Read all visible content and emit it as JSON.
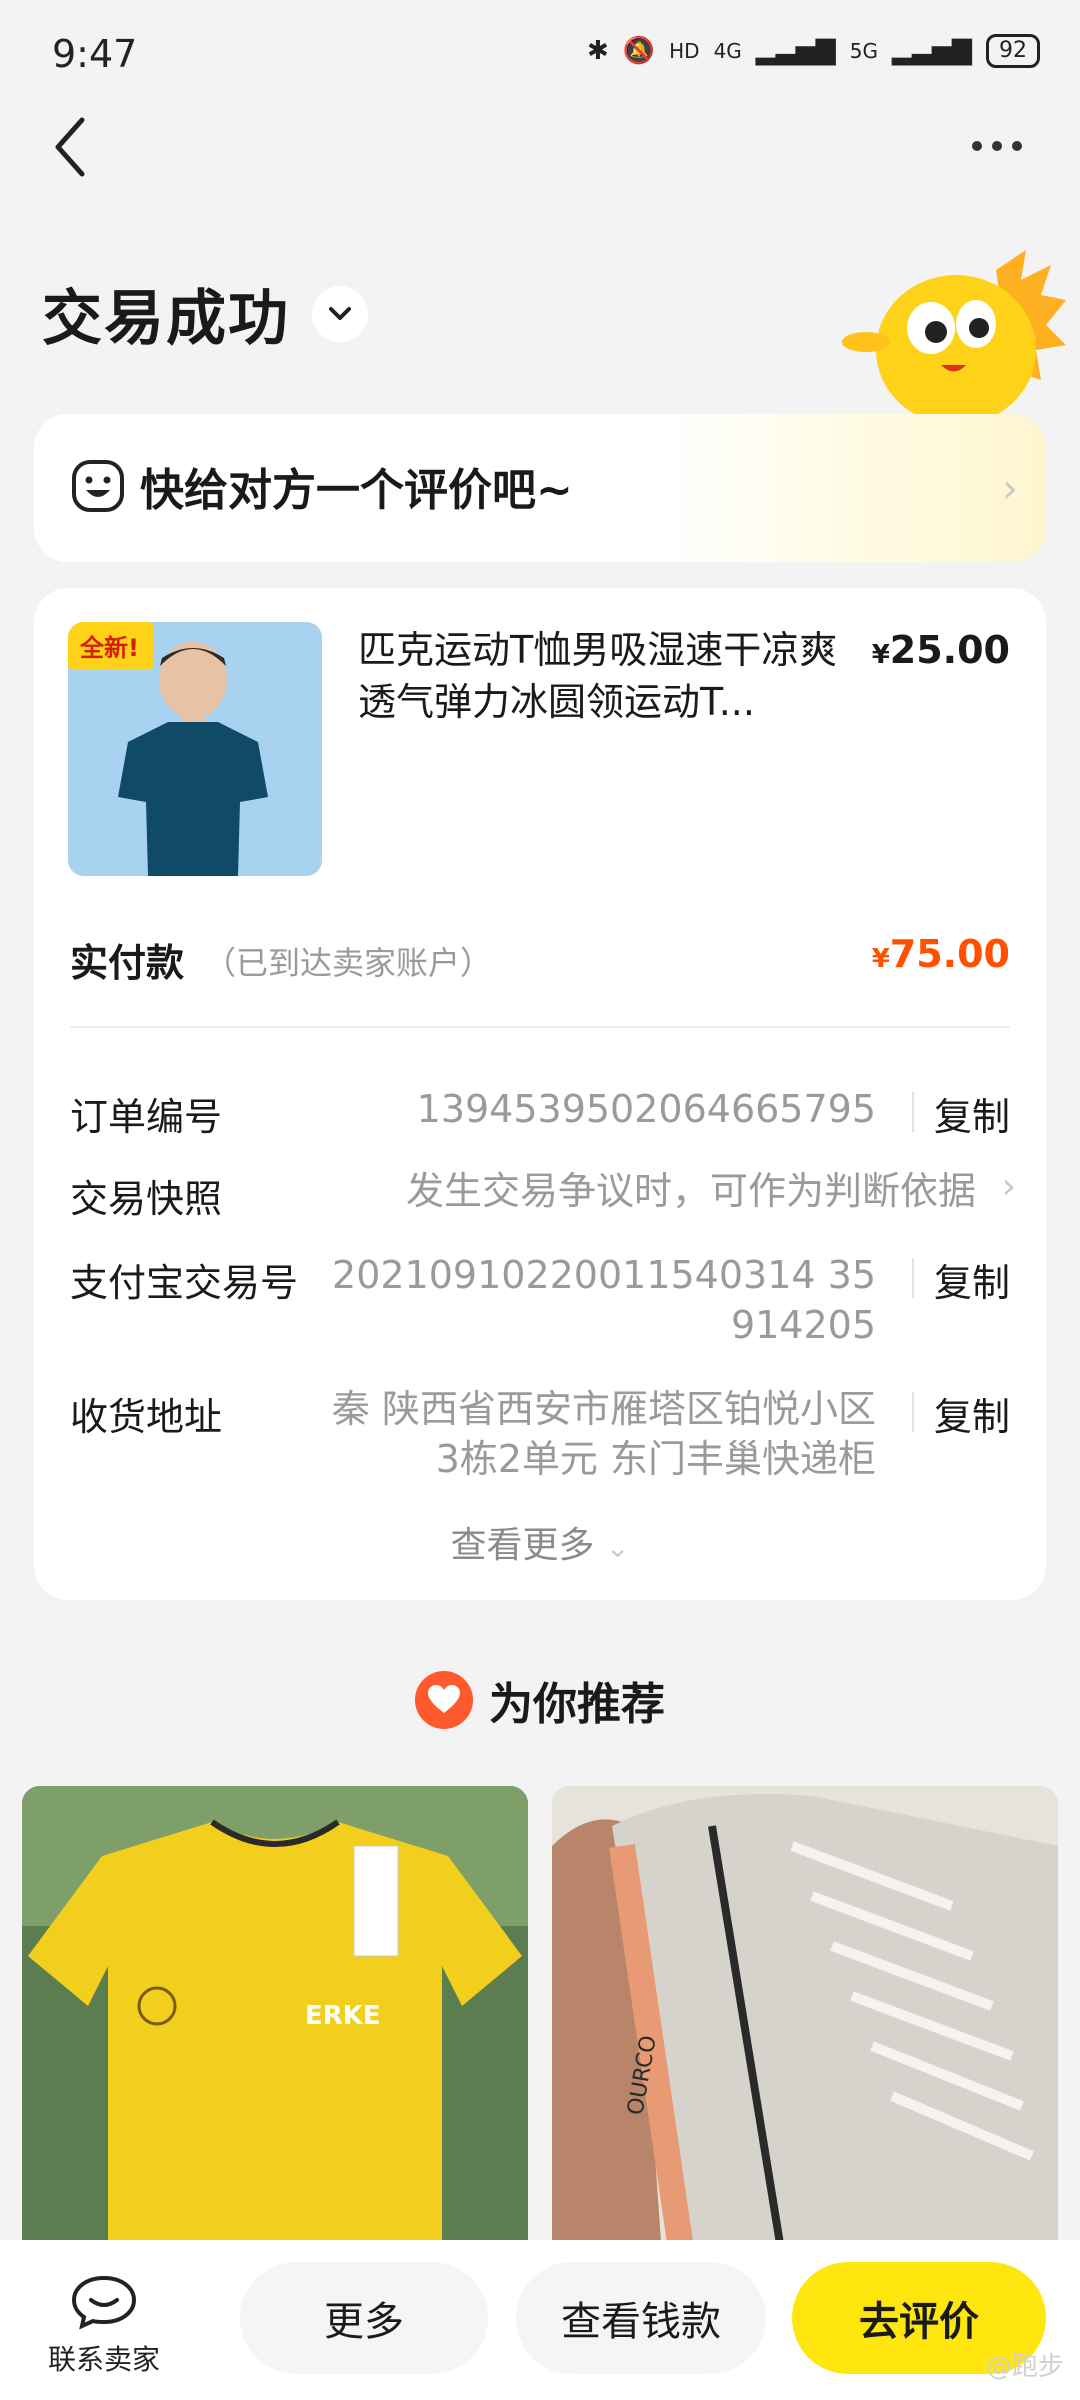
{
  "status_bar": {
    "time": "9:47",
    "network_4g": "4G",
    "network_5g": "5G",
    "hd": "HD",
    "battery": "92"
  },
  "header": {
    "title": "交易成功"
  },
  "review_prompt": {
    "text": "快给对方一个评价吧~"
  },
  "product": {
    "title": "匹克运动T恤男吸湿速干凉爽透气弹力冰圆领运动T...",
    "price_symbol": "¥",
    "price": "25.00",
    "image_badge": "全新!"
  },
  "payment": {
    "label": "实付款",
    "note": "（已到达卖家账户）",
    "amount_symbol": "¥",
    "amount": "75.00"
  },
  "details": {
    "order_no_label": "订单编号",
    "order_no": "1394539502064665795",
    "snapshot_label": "交易快照",
    "snapshot_value": "发生交易争议时，可作为判断依据",
    "alipay_label": "支付宝交易号",
    "alipay_line1": "20210910220011540314 35",
    "alipay_line2": "914205",
    "address_label": "收货地址",
    "address_line1": "秦 陕西省西安市雁塔区铂悦小区",
    "address_line2": "3栋2单元 东门丰巢快递柜",
    "copy_label": "复制",
    "see_more": "查看更多"
  },
  "recommend": {
    "title": "为你推荐",
    "left_brand": "ERKE",
    "right_brand": "ОURCO"
  },
  "bottom_bar": {
    "contact_label": "联系卖家",
    "more_label": "更多",
    "money_label": "查看钱款",
    "review_label": "去评价",
    "watermark": "@跑步"
  },
  "colors": {
    "accent_yellow": "#ffe60f",
    "price_orange": "#ff5000",
    "background": "#f3f3f3"
  }
}
